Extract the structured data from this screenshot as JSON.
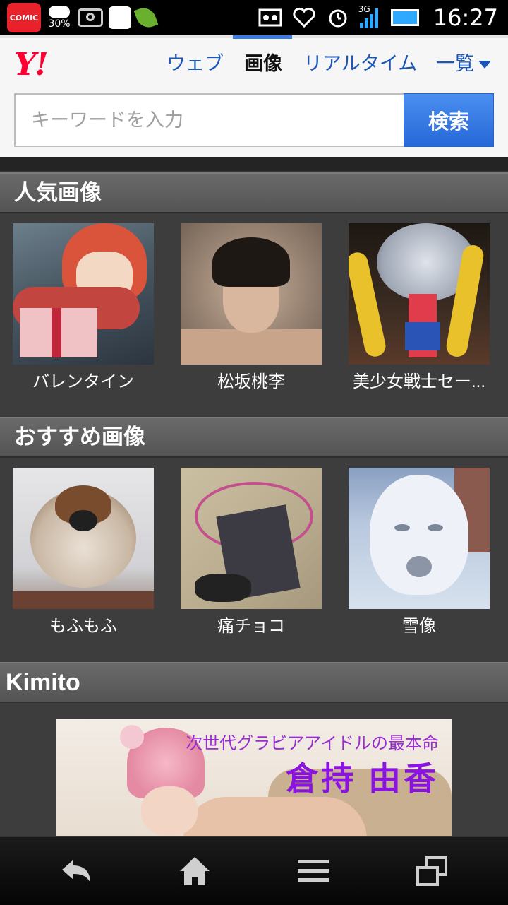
{
  "status_bar": {
    "app_badge": "COMIC",
    "battery_text": "30%",
    "network_type": "3G",
    "time": "16:27"
  },
  "header": {
    "logo": "Y!",
    "tabs": [
      {
        "label": "ウェブ",
        "active": false
      },
      {
        "label": "画像",
        "active": true
      },
      {
        "label": "リアルタイム",
        "active": false
      },
      {
        "label": "一覧",
        "active": false
      }
    ],
    "search": {
      "placeholder": "キーワードを入力",
      "value": "",
      "button_label": "検索"
    }
  },
  "sections": [
    {
      "title": "人気画像",
      "items": [
        {
          "caption": "バレンタイン"
        },
        {
          "caption": "松坂桃李"
        },
        {
          "caption": "美少女戦士セー..."
        }
      ]
    },
    {
      "title": "おすすめ画像",
      "items": [
        {
          "caption": "もふもふ"
        },
        {
          "caption": "痛チョコ"
        },
        {
          "caption": "雪像"
        }
      ]
    },
    {
      "title": "Kimito",
      "banner": {
        "subtitle": "次世代グラビアアイドルの最本命",
        "name": "倉持 由香"
      }
    }
  ],
  "bottom_nav": [
    "back-icon",
    "home-icon",
    "menu-icon",
    "windows-icon"
  ],
  "colors": {
    "accent_blue": "#2668d8",
    "link_blue": "#1a55b8",
    "yahoo_red": "#ff0033",
    "section_bg": "#3d3d3d"
  }
}
